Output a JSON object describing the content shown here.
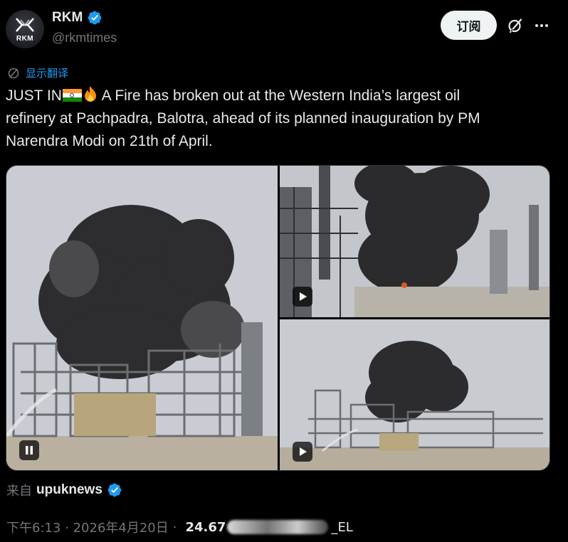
{
  "author": {
    "display_name": "RKM",
    "handle": "@rkmtimes",
    "avatar_text": "RKM",
    "verified": true
  },
  "actions": {
    "follow_label": "订阅"
  },
  "translate_label": "显示翻译",
  "tweet": {
    "line1_prefix": "JUST IN",
    "line1_suffix": " A Fire has broken out at the  Western India’s largest oil",
    "line2": "refinery at Pachpadra, Balotra, ahead of its planned inauguration by PM",
    "line3": "Narendra Modi on 21th of April."
  },
  "media": [
    {
      "kind": "video",
      "state": "playing",
      "control_icon": "pause-icon"
    },
    {
      "kind": "video",
      "state": "paused",
      "control_icon": "play-icon"
    },
    {
      "kind": "video",
      "state": "paused",
      "control_icon": "play-icon"
    }
  ],
  "source": {
    "prefix": "来自",
    "name": "upuknews",
    "verified": true
  },
  "meta": {
    "timestamp": "下午6:13 · 2026年4月20日",
    "views_partial": "24.67",
    "tail": "_EL"
  },
  "colors": {
    "background": "#000000",
    "text": "#e7e9ea",
    "muted": "#71767b",
    "accent": "#1d9bf0"
  }
}
